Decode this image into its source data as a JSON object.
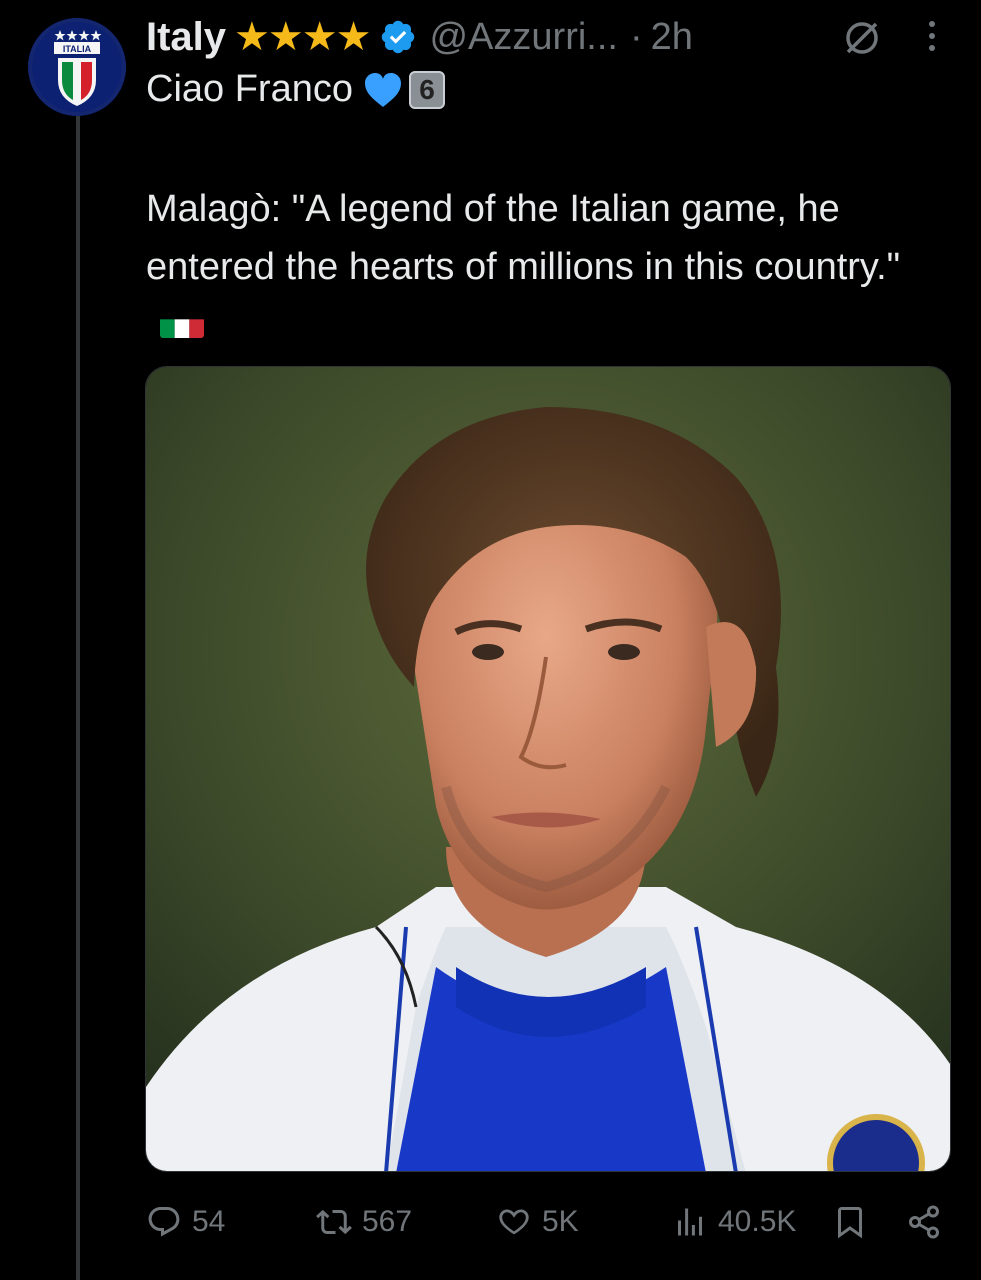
{
  "post": {
    "author_name": "Italy",
    "author_handle": "@Azzurri...",
    "separator": "·",
    "timestamp": "2h",
    "avatar_text": "ITALIA",
    "first_line": "Ciao Franco",
    "keycap_number": "6",
    "body": "Malagò: \"A legend of the Italian game, he entered the hearts of millions in this country.\""
  },
  "actions": {
    "replies": "54",
    "reposts": "567",
    "likes": "5K",
    "views": "40.5K"
  },
  "colors": {
    "background": "#000000",
    "text": "#e7e9ea",
    "muted": "#71767b",
    "verified": "#1d9bf0",
    "star": "#f5b91a",
    "heart": "#3aa0ff"
  },
  "icons": {
    "verified": "verified-badge-icon",
    "grok": "grok-icon",
    "more": "more-options-icon",
    "reply": "reply-icon",
    "repost": "repost-icon",
    "like": "like-icon",
    "views": "views-icon",
    "bookmark": "bookmark-icon",
    "share": "share-icon"
  }
}
